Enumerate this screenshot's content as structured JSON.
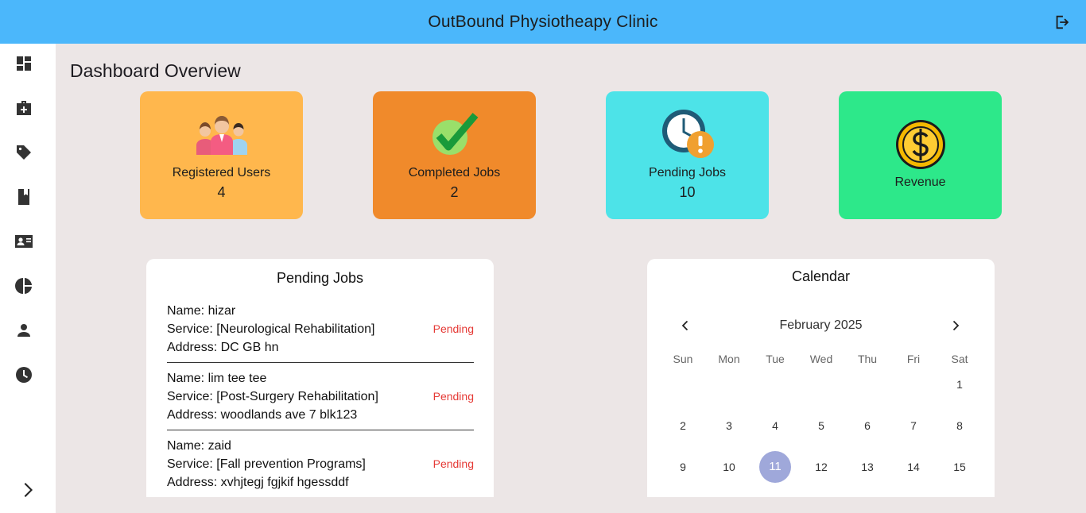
{
  "app": {
    "title": "OutBound Physiotheapy Clinic"
  },
  "page": {
    "heading": "Dashboard Overview"
  },
  "nav": {
    "items": [
      "dashboard-icon",
      "medical-kit-icon",
      "tag-icon",
      "book-icon",
      "contact-card-icon",
      "pie-chart-icon",
      "person-icon",
      "clock-icon"
    ]
  },
  "stats": {
    "registered": {
      "label": "Registered Users",
      "value": "4",
      "color": "#ffb74d"
    },
    "completed": {
      "label": "Completed Jobs",
      "value": "2",
      "color": "#f08a2b"
    },
    "pending": {
      "label": "Pending Jobs",
      "value": "10",
      "color": "#4de3e8"
    },
    "revenue": {
      "label": "Revenue",
      "color": "#2de88a"
    }
  },
  "pending_jobs": {
    "title": "Pending Jobs",
    "items": [
      {
        "name": "Name: hizar",
        "service": "Service: [Neurological Rehabilitation]",
        "address": "Address: DC GB hn",
        "status": "Pending"
      },
      {
        "name": "Name: lim tee tee",
        "service": "Service: [Post-Surgery Rehabilitation]",
        "address": "Address: woodlands ave 7 blk123",
        "status": "Pending"
      },
      {
        "name": "Name: zaid",
        "service": "Service: [Fall prevention Programs]",
        "address": "Address: xvhjtegj fgjkif hgessddf",
        "status": "Pending"
      }
    ]
  },
  "calendar": {
    "title": "Calendar",
    "month": "February 2025",
    "weekdays": [
      "Sun",
      "Mon",
      "Tue",
      "Wed",
      "Thu",
      "Fri",
      "Sat"
    ],
    "weeks": [
      [
        "",
        "",
        "",
        "",
        "",
        "",
        "1"
      ],
      [
        "2",
        "3",
        "4",
        "5",
        "6",
        "7",
        "8"
      ],
      [
        "9",
        "10",
        "11",
        "12",
        "13",
        "14",
        "15"
      ]
    ],
    "selected": "11"
  }
}
